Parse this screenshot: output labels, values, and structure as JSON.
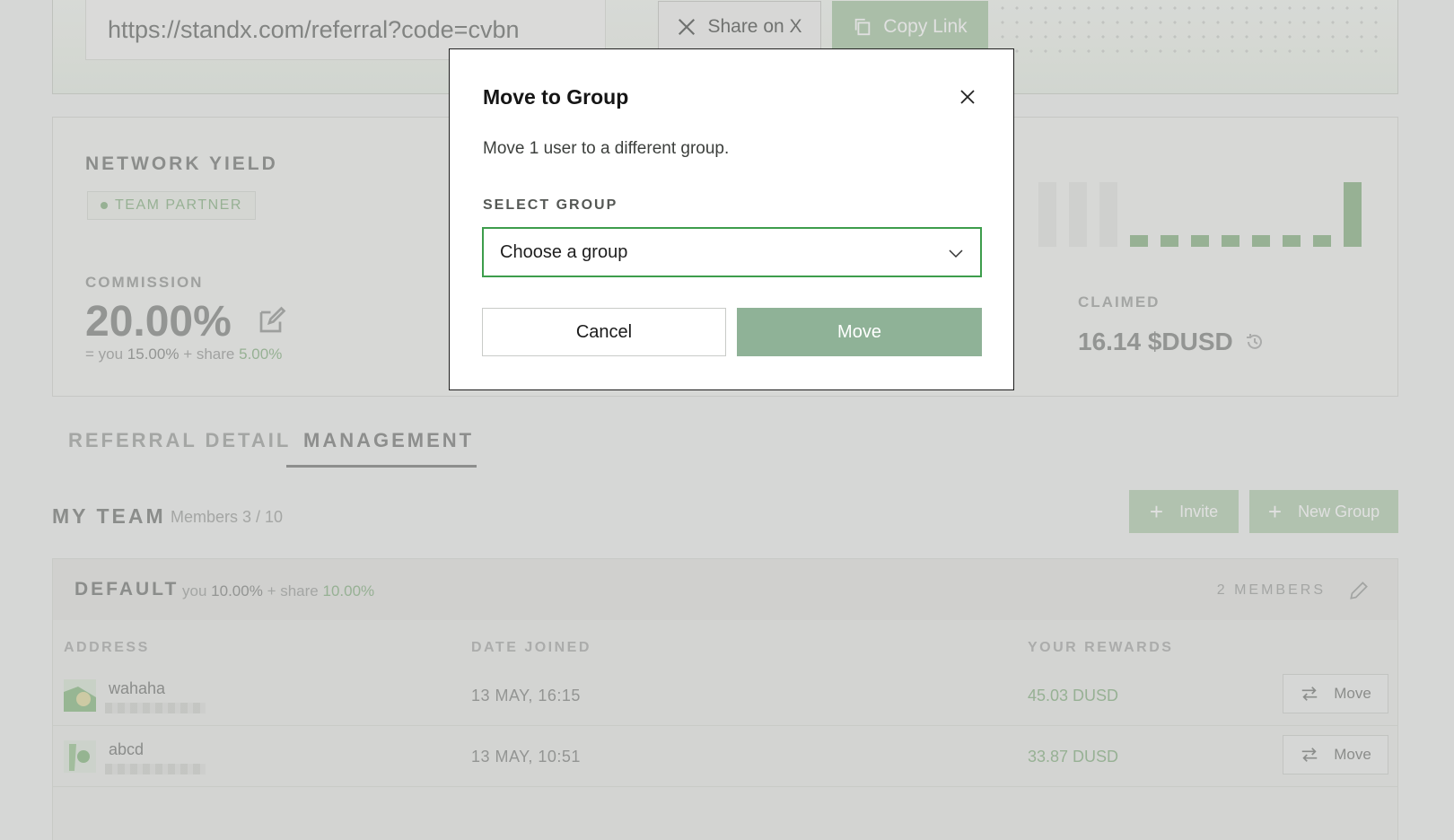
{
  "referral": {
    "url": "https://standx.com/referral?code=cvbn",
    "share_label": "Share on X",
    "copy_label": "Copy Link"
  },
  "yield": {
    "title": "NETWORK YIELD",
    "badge": "TEAM PARTNER",
    "commission_label": "COMMISSION",
    "commission_value": "20.00%",
    "split_prefix": "= you",
    "split_you": "15.00%",
    "split_mid": "+ share",
    "split_share": "5.00%",
    "claimed_label": "CLAIMED",
    "claimed_value": "16.14 $DUSD",
    "activity_levels": [
      0,
      0,
      0,
      0.18,
      0.18,
      0.18,
      0.18,
      0.18,
      0.18,
      0.18,
      1
    ]
  },
  "tabs": {
    "referral_detail": "REFERRAL DETAIL",
    "management": "MANAGEMENT"
  },
  "team": {
    "title": "MY TEAM",
    "members": "Members 3 / 10",
    "invite_label": "Invite",
    "new_group_label": "New Group"
  },
  "group": {
    "name": "DEFAULT",
    "split_prefix": "you",
    "split_you": "10.00%",
    "split_mid": "+ share",
    "split_share": "10.00%",
    "member_count": "2 MEMBERS",
    "columns": {
      "address": "ADDRESS",
      "date_joined": "DATE JOINED",
      "your_rewards": "YOUR REWARDS"
    },
    "rows": [
      {
        "name": "wahaha",
        "date": "13 MAY, 16:15",
        "reward": "45.03 DUSD",
        "action": "Move"
      },
      {
        "name": "abcd",
        "date": "13 MAY, 10:51",
        "reward": "33.87 DUSD",
        "action": "Move"
      }
    ]
  },
  "modal": {
    "title": "Move to Group",
    "description": "Move 1 user to a different group.",
    "select_label": "SELECT GROUP",
    "select_placeholder": "Choose a group",
    "cancel_label": "Cancel",
    "confirm_label": "Move"
  },
  "colors": {
    "accent_green": "#8fb297",
    "focus_green": "#3d9d4c",
    "muted_green": "#a8c7a5"
  }
}
